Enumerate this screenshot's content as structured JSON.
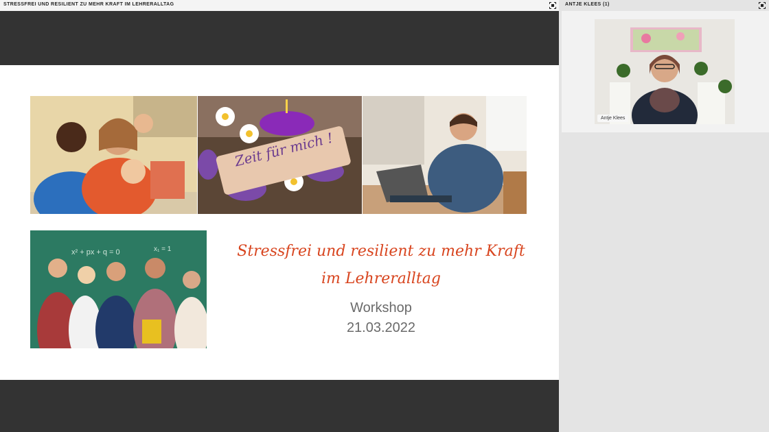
{
  "meeting": {
    "presentation_title": "STRESSFREI UND RESILIENT ZU MEHR KRAFT IM LEHRERALLTAG",
    "participants_label": "ANTJE KLEES (1)"
  },
  "slide": {
    "title_line1": "Stressfrei und resilient zu mehr Kraft",
    "title_line2": "im Lehreralltag",
    "subtitle": "Workshop",
    "date": "21.03.2022",
    "tag_text": "Zeit für mich !"
  },
  "participant": {
    "name": "Antje Klees"
  },
  "icons": {
    "expand": "fullscreen-icon"
  },
  "colors": {
    "accent": "#d8451f",
    "presentation_bg": "#333333",
    "panel_bg": "#f2f2f2"
  }
}
